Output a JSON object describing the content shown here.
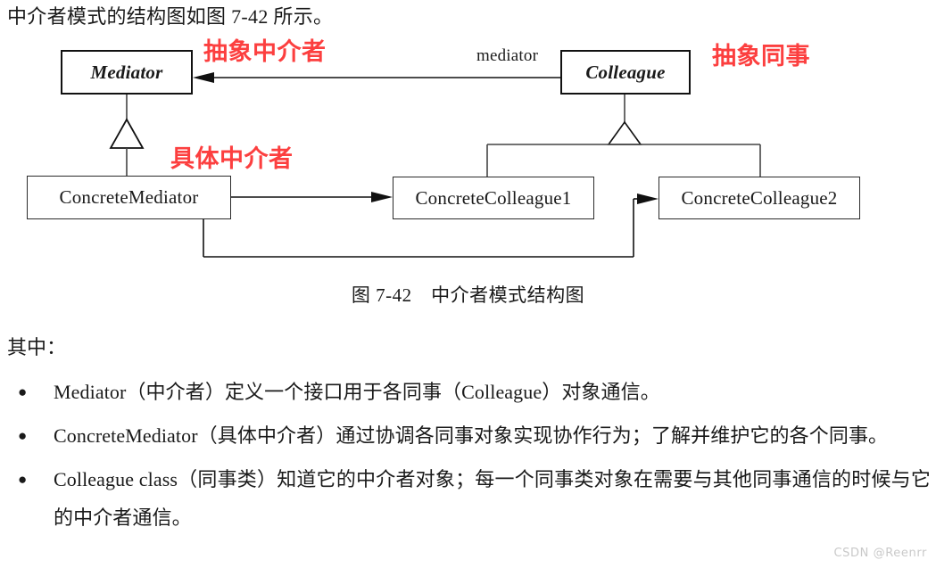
{
  "page": {
    "intro_line": "中介者模式的结构图如图 7-42 所示。",
    "figure_caption": "图 7-42　中介者模式结构图",
    "section_label": "其中：",
    "watermark": "CSDN @Reenrr"
  },
  "diagram": {
    "title": "中介者模式结构图",
    "boxes": [
      {
        "id": "mediator",
        "label": "Mediator",
        "stereotype": "abstract"
      },
      {
        "id": "colleague",
        "label": "Colleague",
        "stereotype": "abstract"
      },
      {
        "id": "concrete_mediator",
        "label": "ConcreteMediator",
        "stereotype": "concrete"
      },
      {
        "id": "concrete_colleague1",
        "label": "ConcreteColleague1",
        "stereotype": "concrete"
      },
      {
        "id": "concrete_colleague2",
        "label": "ConcreteColleague2",
        "stereotype": "concrete"
      }
    ],
    "association_label": "mediator",
    "annotations": [
      {
        "id": "abstract_mediator",
        "text": "抽象中介者",
        "color": "#fc3f3f"
      },
      {
        "id": "abstract_colleague",
        "text": "抽象同事",
        "color": "#fc3f3f"
      },
      {
        "id": "concrete_mediator",
        "text": "具体中介者",
        "color": "#fc3f3f"
      }
    ],
    "relations": [
      {
        "from": "colleague",
        "to": "mediator",
        "type": "association",
        "label": "mediator"
      },
      {
        "from": "concrete_mediator",
        "to": "mediator",
        "type": "generalization"
      },
      {
        "from": "concrete_colleague1",
        "to": "colleague",
        "type": "generalization"
      },
      {
        "from": "concrete_colleague2",
        "to": "colleague",
        "type": "generalization"
      },
      {
        "from": "concrete_mediator",
        "to": "concrete_colleague1",
        "type": "association"
      },
      {
        "from": "concrete_mediator",
        "to": "concrete_colleague2",
        "type": "association"
      }
    ]
  },
  "bullets": [
    {
      "marker": "●",
      "text": "Mediator（中介者）定义一个接口用于各同事（Colleague）对象通信。"
    },
    {
      "marker": "●",
      "text": "ConcreteMediator（具体中介者）通过协调各同事对象实现协作行为；了解并维护它的各个同事。"
    },
    {
      "marker": "●",
      "text": "Colleague class（同事类）知道它的中介者对象；每一个同事类对象在需要与其他同事通信的时候与它的中介者通信。"
    }
  ]
}
